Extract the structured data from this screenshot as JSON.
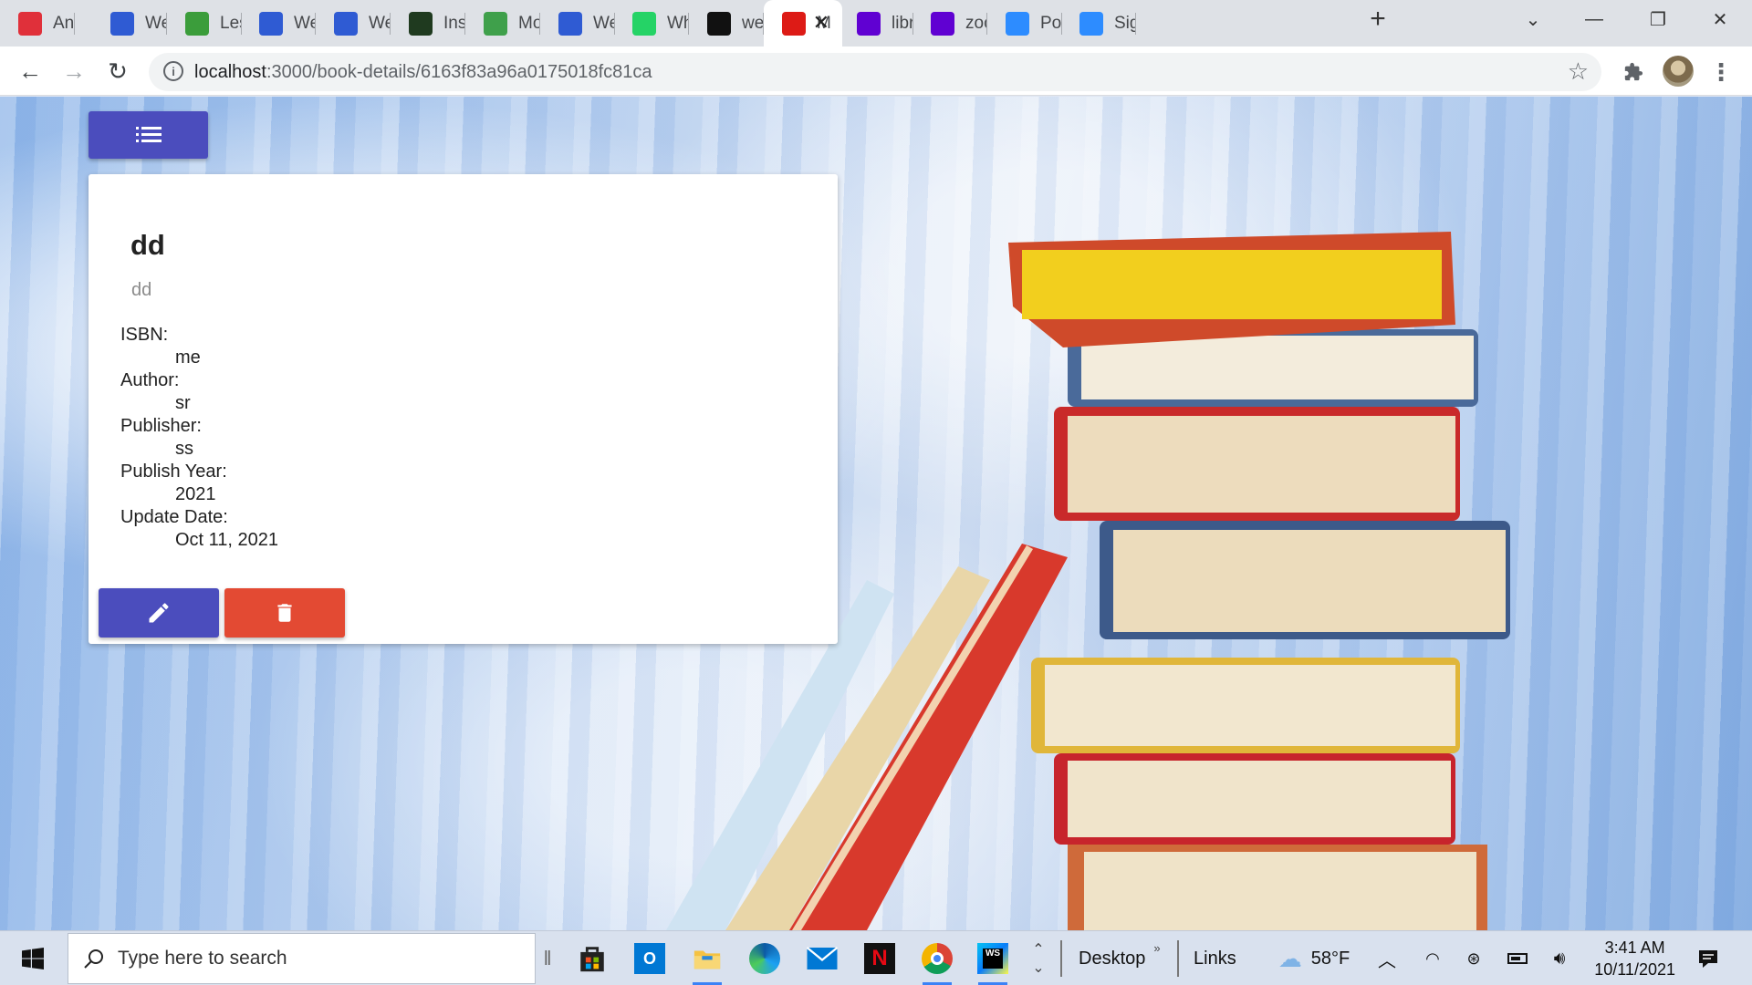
{
  "browser": {
    "tabs": [
      {
        "title": "Anno",
        "icon": "gear-red-icon",
        "color": "#e0303a"
      },
      {
        "title": "Web_",
        "icon": "box-icon",
        "color": "#2f5bd3"
      },
      {
        "title": "Lesso",
        "icon": "green-logo-icon",
        "color": "#3b9d3b"
      },
      {
        "title": "Web_",
        "icon": "box-icon",
        "color": "#2f5bd3"
      },
      {
        "title": "Web_",
        "icon": "box-icon",
        "color": "#2f5bd3"
      },
      {
        "title": "Insta",
        "icon": "leaf-dark-icon",
        "color": "#1f3a1f"
      },
      {
        "title": "Mong",
        "icon": "leaf-green-icon",
        "color": "#3fa04b"
      },
      {
        "title": "Web_",
        "icon": "box-icon",
        "color": "#2f5bd3"
      },
      {
        "title": "What",
        "icon": "whatsapp-icon",
        "color": "#25d366"
      },
      {
        "title": "web",
        "icon": "github-icon",
        "color": "#111111"
      },
      {
        "title": "M",
        "icon": "angular-icon",
        "color": "#dd1b16",
        "active": true
      },
      {
        "title": "librar",
        "icon": "yahoo-icon",
        "color": "#6001d2"
      },
      {
        "title": "zoon",
        "icon": "yahoo-icon",
        "color": "#6001d2"
      },
      {
        "title": "Post",
        "icon": "zoom-icon",
        "color": "#2d8cff"
      },
      {
        "title": "Sign",
        "icon": "zoom-icon",
        "color": "#2d8cff"
      }
    ],
    "url_host": "localhost",
    "url_path": ":3000/book-details/6163f83a96a0175018fc81ca"
  },
  "book": {
    "title": "dd",
    "subtitle": "dd",
    "fields": [
      {
        "label": "ISBN:",
        "value": "me"
      },
      {
        "label": "Author:",
        "value": "sr"
      },
      {
        "label": "Publisher:",
        "value": "ss"
      },
      {
        "label": "Publish Year:",
        "value": "2021"
      },
      {
        "label": "Update Date:",
        "value": "Oct 11, 2021"
      }
    ]
  },
  "actions": {
    "edit_icon": "pencil-icon",
    "delete_icon": "trash-icon",
    "menu_icon": "list-icon"
  },
  "taskbar": {
    "search_placeholder": "Type here to search",
    "desktop_label": "Desktop",
    "links_label": "Links",
    "weather": "58°F",
    "time": "3:41 AM",
    "date": "10/11/2021"
  },
  "colors": {
    "primary": "#4b4dbd",
    "danger": "#e34a33"
  }
}
